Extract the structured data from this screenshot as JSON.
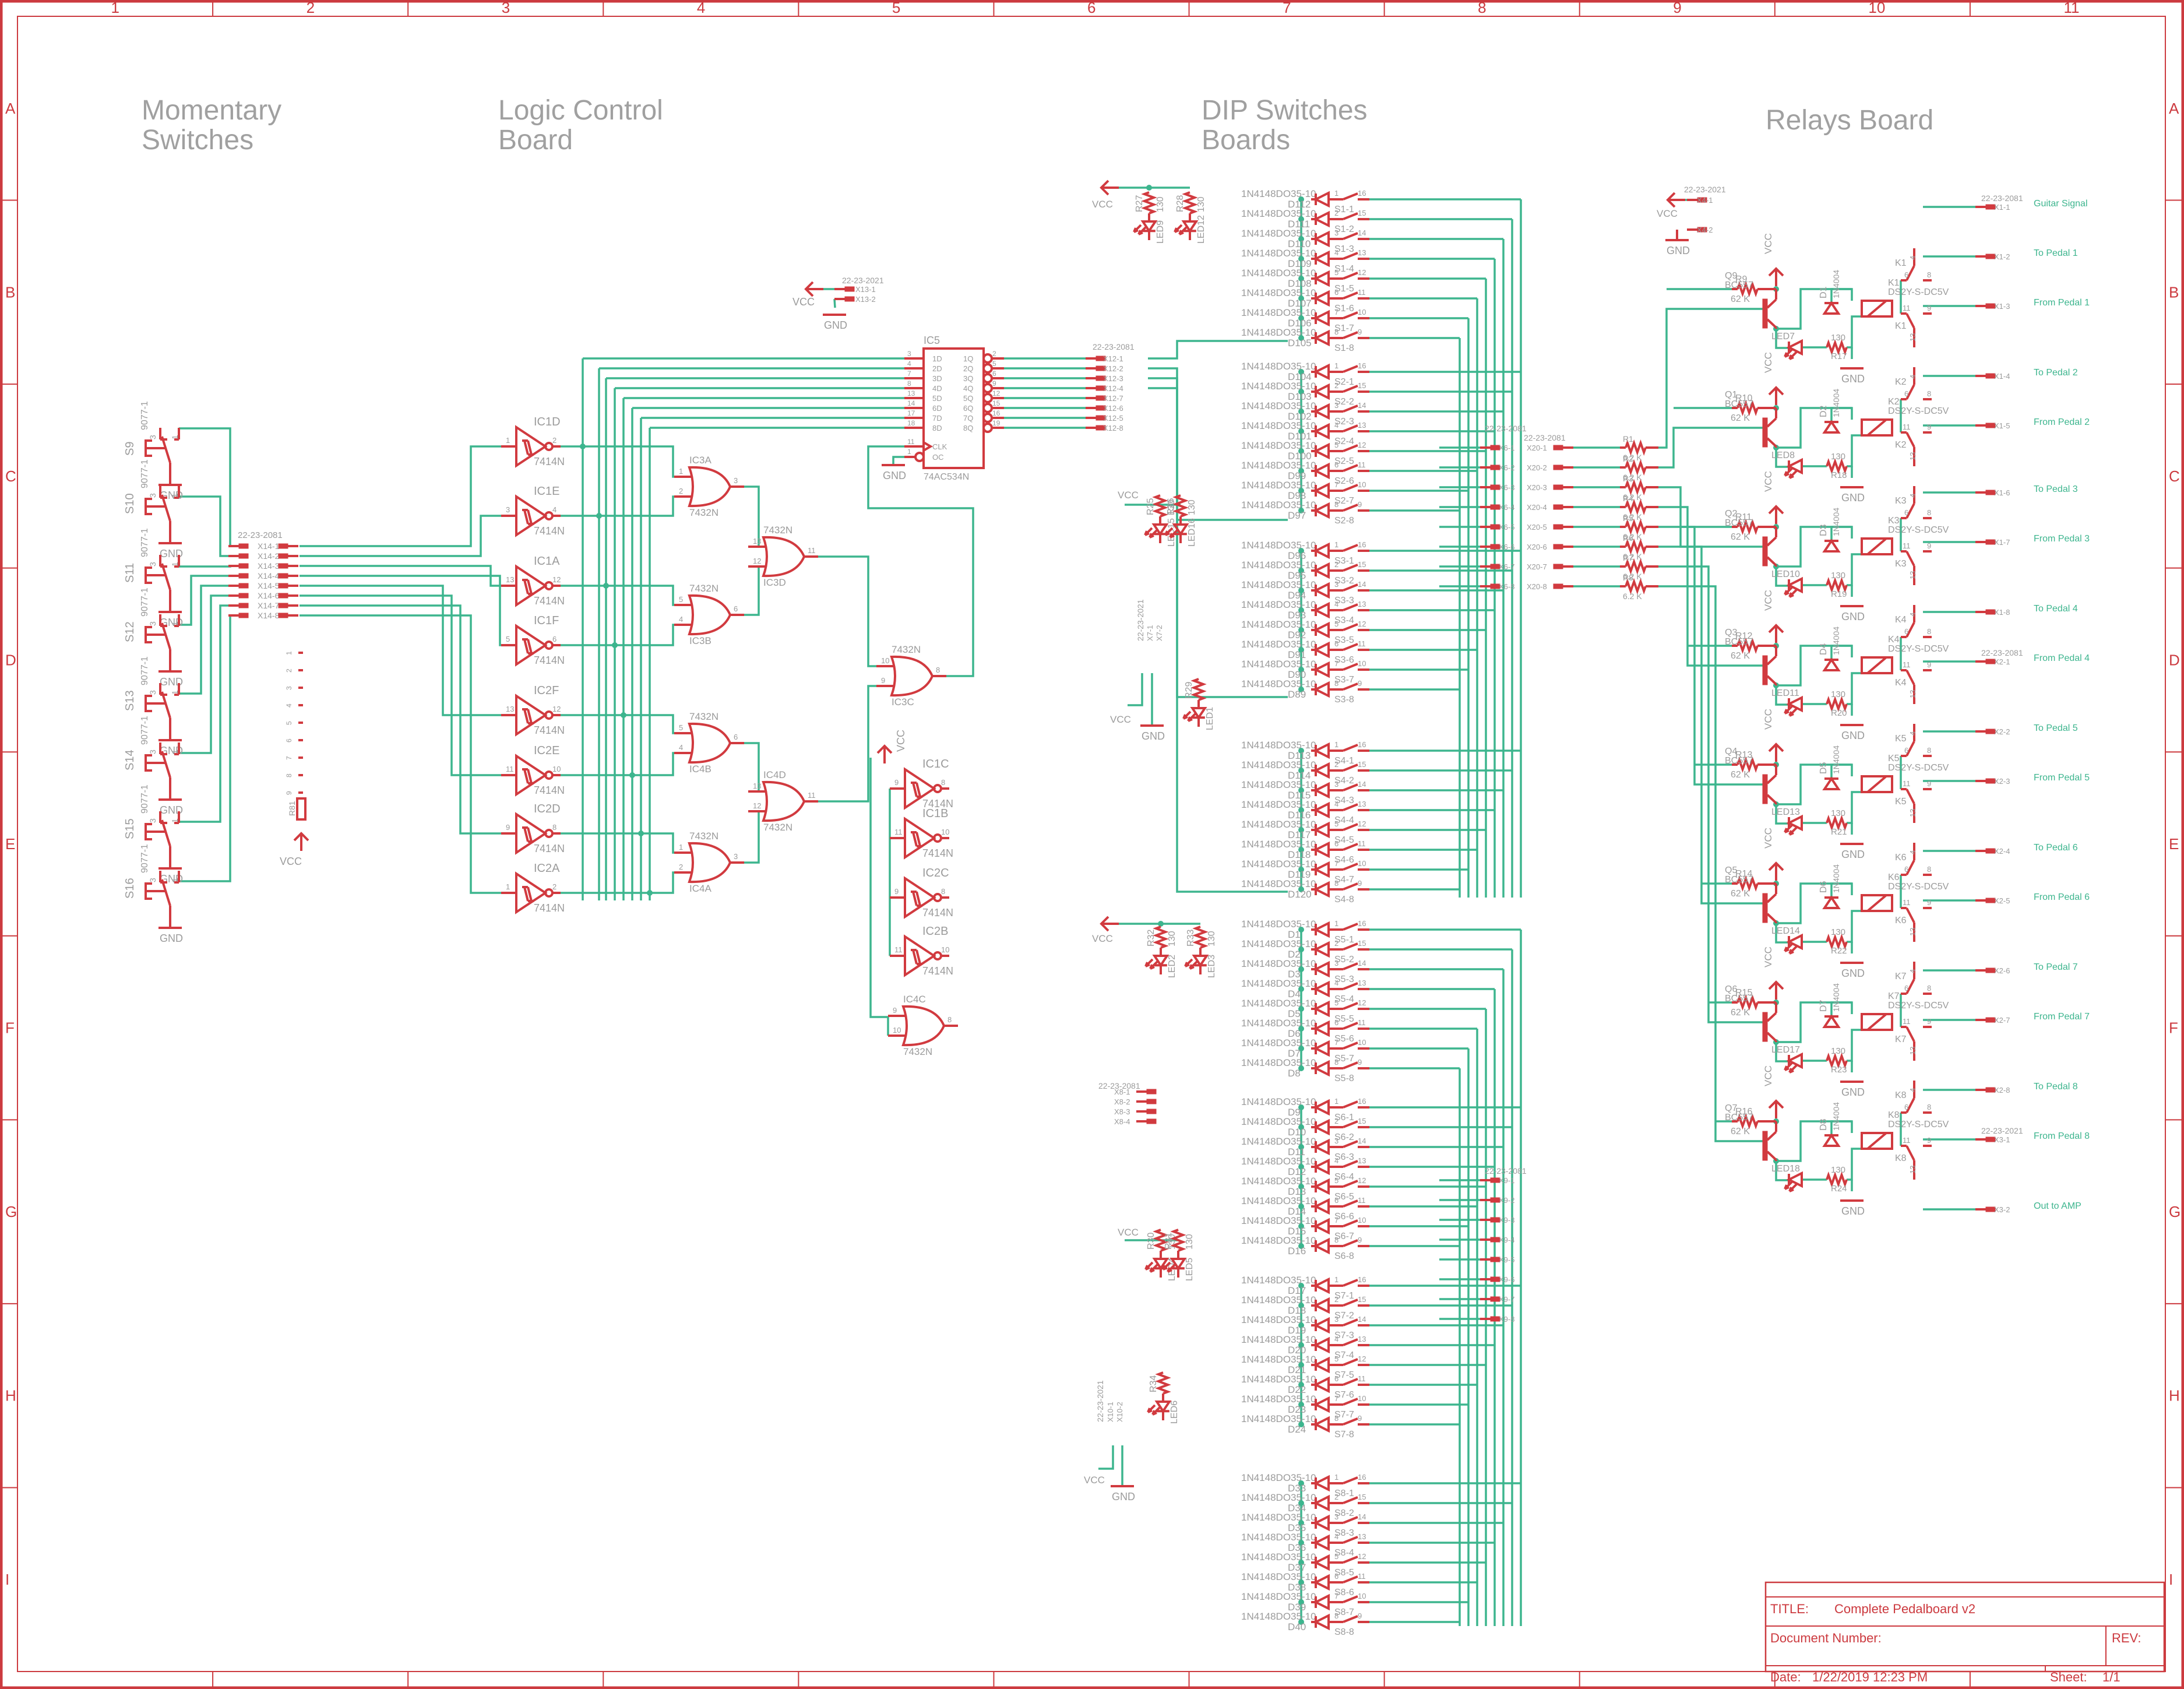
{
  "sheet": {
    "columns": [
      "1",
      "2",
      "3",
      "4",
      "5",
      "6",
      "7",
      "8",
      "9",
      "10",
      "11"
    ],
    "rows": [
      "A",
      "B",
      "C",
      "D",
      "E",
      "F",
      "G",
      "H",
      "I"
    ],
    "colors": {
      "frame": "#cc3a3f",
      "symbol": "#d13a3f",
      "wire": "#3db58e",
      "label": "#9b9b9b",
      "section": "#a0a0a0"
    }
  },
  "sections": {
    "momentary": [
      "Momentary",
      "Switches"
    ],
    "logic": [
      "Logic Control",
      "Board"
    ],
    "dip": [
      "DIP Switches",
      "Boards"
    ],
    "relays": [
      "Relays Board"
    ]
  },
  "title_block": {
    "title_label": "TITLE:",
    "title": "Complete Pedalboard v2",
    "docnum_label": "Document Number:",
    "rev_label": "REV:",
    "date_label": "Date:",
    "date": "1/22/2019 12:23 PM",
    "sheet_label": "Sheet:",
    "sheet": "1/1"
  },
  "momentary_switches": {
    "part": "9077-1",
    "gnd": "GND",
    "items": [
      "S9",
      "S10",
      "S11",
      "S12",
      "S13",
      "S14",
      "S15",
      "S16"
    ],
    "connector_part": "22-23-2081",
    "connector_pins": [
      "X14-1",
      "X14-2",
      "X14-3",
      "X14-4",
      "X14-5",
      "X14-6",
      "X14-7",
      "X14-8"
    ],
    "resistor": "R81",
    "vcc": "VCC"
  },
  "logic_board": {
    "inverters_left": [
      {
        "name": "IC1D",
        "part": "7414N",
        "in": "1",
        "out": "2"
      },
      {
        "name": "IC1E",
        "part": "7414N",
        "in": "3",
        "out": "4"
      },
      {
        "name": "IC1A",
        "part": "7414N",
        "in": "13",
        "out": "12"
      },
      {
        "name": "IC1F",
        "part": "7414N",
        "in": "5",
        "out": "6"
      },
      {
        "name": "IC2F",
        "part": "7414N",
        "in": "13",
        "out": "12"
      },
      {
        "name": "IC2E",
        "part": "7414N",
        "in": "11",
        "out": "10"
      },
      {
        "name": "IC2D",
        "part": "7414N",
        "in": "9",
        "out": "8"
      },
      {
        "name": "IC2A",
        "part": "7414N",
        "in": "1",
        "out": "2"
      }
    ],
    "or_gates": [
      {
        "name": "IC3A",
        "part": "7432N",
        "in": [
          "1",
          "2"
        ],
        "out": "3"
      },
      {
        "name": "IC3B",
        "part": "7432N",
        "in": [
          "5",
          "4"
        ],
        "out": "6"
      },
      {
        "name": "IC3D",
        "part": "7432N",
        "in": [
          "13",
          "12"
        ],
        "out": "11"
      },
      {
        "name": "IC4B",
        "part": "7432N",
        "in": [
          "5",
          "4"
        ],
        "out": "6"
      },
      {
        "name": "IC4A",
        "part": "7432N",
        "in": [
          "1",
          "2"
        ],
        "out": "3"
      },
      {
        "name": "IC4D",
        "part": "7432N",
        "in": [
          "13",
          "12"
        ],
        "out": "11"
      },
      {
        "name": "IC3C",
        "part": "7432N",
        "in": [
          "10",
          "9"
        ],
        "out": "8"
      },
      {
        "name": "IC4C",
        "part": "7432N",
        "in": [
          "9",
          "10"
        ],
        "out": "8"
      }
    ],
    "inverters_unused": [
      {
        "name": "IC1C",
        "part": "7414N",
        "in": "9",
        "out": "8"
      },
      {
        "name": "IC1B",
        "part": "7414N",
        "in": "11",
        "out": "10"
      },
      {
        "name": "IC2C",
        "part": "7414N",
        "in": "9",
        "out": "8"
      },
      {
        "name": "IC2B",
        "part": "7414N",
        "in": "11",
        "out": "10"
      }
    ],
    "latch": {
      "name": "IC5",
      "part": "74AC534N",
      "d_pins": [
        [
          "3",
          "1D"
        ],
        [
          "4",
          "2D"
        ],
        [
          "7",
          "3D"
        ],
        [
          "8",
          "4D"
        ],
        [
          "13",
          "5D"
        ],
        [
          "14",
          "6D"
        ],
        [
          "17",
          "7D"
        ],
        [
          "18",
          "8D"
        ]
      ],
      "q_pins": [
        [
          "2",
          "1Q"
        ],
        [
          "5",
          "2Q"
        ],
        [
          "6",
          "3Q"
        ],
        [
          "9",
          "4Q"
        ],
        [
          "12",
          "5Q"
        ],
        [
          "15",
          "6Q"
        ],
        [
          "16",
          "7Q"
        ],
        [
          "19",
          "8Q"
        ]
      ],
      "clk": [
        "11",
        "CLK"
      ],
      "oc": [
        "1",
        "OC"
      ]
    },
    "latch_connector_part": "22-23-2081",
    "latch_connector_pins": [
      "X12-1",
      "X12-2",
      "X12-3",
      "X12-4",
      "X12-7",
      "X12-6",
      "X12-5",
      "X12-8"
    ],
    "power_connector": {
      "part": "22-23-2021",
      "pins": [
        "X13-1",
        "X13-2"
      ]
    },
    "vcc": "VCC",
    "gnd": "GND"
  },
  "dip_boards": {
    "diode_part": "1N4148DO35-10",
    "banks": [
      {
        "switch": "S1",
        "diodes": [
          "D112",
          "D111",
          "D110",
          "D109",
          "D108",
          "D107",
          "D106",
          "D105"
        ]
      },
      {
        "switch": "S2",
        "diodes": [
          "D104",
          "D103",
          "D102",
          "D101",
          "D100",
          "D99",
          "D98",
          "D97"
        ]
      },
      {
        "switch": "S3",
        "diodes": [
          "D96",
          "D95",
          "D94",
          "D93",
          "D92",
          "D91",
          "D90",
          "D89"
        ]
      },
      {
        "switch": "S4",
        "diodes": [
          "D113",
          "D114",
          "D115",
          "D116",
          "D117",
          "D118",
          "D119",
          "D120"
        ]
      },
      {
        "switch": "S5",
        "diodes": [
          "D1",
          "D2",
          "D3",
          "D4",
          "D5",
          "D6",
          "D7",
          "D8"
        ]
      },
      {
        "switch": "S6",
        "diodes": [
          "D9",
          "D10",
          "D11",
          "D12",
          "D13",
          "D14",
          "D15",
          "D16"
        ]
      },
      {
        "switch": "S7",
        "diodes": [
          "D17",
          "D18",
          "D19",
          "D20",
          "D21",
          "D22",
          "D23",
          "D24"
        ]
      },
      {
        "switch": "S8",
        "diodes": [
          "D33",
          "D34",
          "D35",
          "D36",
          "D37",
          "D38",
          "D39",
          "D40"
        ]
      }
    ],
    "left_pins": [
      "1",
      "2",
      "3",
      "4",
      "5",
      "6",
      "7",
      "8"
    ],
    "right_pins": [
      "16",
      "15",
      "14",
      "13",
      "12",
      "11",
      "10",
      "9"
    ],
    "indicator_leds": [
      {
        "r": "R27",
        "v": "130",
        "led": "LED9"
      },
      {
        "r": "R28",
        "v": "130",
        "led": "LED12"
      },
      {
        "r": "R25",
        "v": "130",
        "led": "LED15"
      },
      {
        "r": "R26",
        "v": "130",
        "led": "LED16"
      },
      {
        "r": "R29",
        "v": "",
        "led": "LED1"
      },
      {
        "r": "R32",
        "v": "130",
        "led": "LED2"
      },
      {
        "r": "R33",
        "v": "130",
        "led": "LED3"
      },
      {
        "r": "R30",
        "v": "130",
        "led": "LED4"
      },
      {
        "r": "R31",
        "v": "130",
        "led": "LED5"
      },
      {
        "r": "R34",
        "v": "",
        "led": "LED6"
      }
    ],
    "connectors": {
      "x6": {
        "part": "22-23-2081",
        "pins": [
          "X6-1",
          "X6-2",
          "X6-3",
          "X6-4",
          "X6-5",
          "X6-6",
          "X6-7",
          "X6-8"
        ]
      },
      "x7": {
        "part": "22-23-2021",
        "pins": [
          "X7-1",
          "X7-2"
        ]
      },
      "x8": {
        "part": "22-23-2081",
        "pins": [
          "X8-1",
          "X8-2",
          "X8-3",
          "X8-4"
        ]
      },
      "x9": {
        "part": "22-23-2081",
        "pins": [
          "X9-1",
          "X9-2",
          "X9-3",
          "X9-4",
          "X9-5",
          "X9-6",
          "X9-7",
          "X9-8"
        ]
      },
      "x10": {
        "part": "22-23-2021",
        "pins": [
          "X10-1",
          "X10-2"
        ]
      }
    },
    "vcc": "VCC",
    "gnd": "GND"
  },
  "relay_board": {
    "input_connector": {
      "part": "22-23-2081",
      "pins": [
        "X20-1",
        "X20-2",
        "X20-3",
        "X20-4",
        "X20-5",
        "X20-6",
        "X20-7",
        "X20-8"
      ]
    },
    "input_resistors": [
      {
        "name": "R1",
        "value": "6.2 K"
      },
      {
        "name": "R2",
        "value": "6.2 K"
      },
      {
        "name": "R3",
        "value": "6.2 K"
      },
      {
        "name": "R4",
        "value": "6.2 K"
      },
      {
        "name": "R5",
        "value": "6.2 K"
      },
      {
        "name": "R6",
        "value": "6.2 K"
      },
      {
        "name": "R7",
        "value": "6.2 K"
      },
      {
        "name": "R8",
        "value": "6.2 K"
      }
    ],
    "power_connector": {
      "part": "22-23-2021",
      "pins": [
        "X4-1",
        "X4-2"
      ]
    },
    "channels": [
      {
        "q": "Q9",
        "qpart": "BC557",
        "rb": "R9",
        "rbv": "62 K",
        "d": "D1",
        "dpart": "1N4004",
        "k": "K1",
        "kpart": "DS2Y-S-DC5V",
        "led": "LED7",
        "rl": "R17",
        "rlv": "130"
      },
      {
        "q": "Q1",
        "qpart": "BC557",
        "rb": "R10",
        "rbv": "62 K",
        "d": "D2",
        "dpart": "1N4004",
        "k": "K2",
        "kpart": "DS2Y-S-DC5V",
        "led": "LED8",
        "rl": "R18",
        "rlv": "130"
      },
      {
        "q": "Q2",
        "qpart": "BC557",
        "rb": "R11",
        "rbv": "62 K",
        "d": "D3",
        "dpart": "1N4004",
        "k": "K3",
        "kpart": "DS2Y-S-DC5V",
        "led": "LED10",
        "rl": "R19",
        "rlv": "130"
      },
      {
        "q": "Q3",
        "qpart": "BC557",
        "rb": "R12",
        "rbv": "62 K",
        "d": "D4",
        "dpart": "1N4004",
        "k": "K4",
        "kpart": "DS2Y-S-DC5V",
        "led": "LED11",
        "rl": "R20",
        "rlv": "130"
      },
      {
        "q": "Q4",
        "qpart": "BC557",
        "rb": "R13",
        "rbv": "62 K",
        "d": "D5",
        "dpart": "1N4004",
        "k": "K5",
        "kpart": "DS2Y-S-DC5V",
        "led": "LED13",
        "rl": "R21",
        "rlv": "130"
      },
      {
        "q": "Q5",
        "qpart": "BC557",
        "rb": "R14",
        "rbv": "62 K",
        "d": "D6",
        "dpart": "1N4004",
        "k": "K6",
        "kpart": "DS2Y-S-DC5V",
        "led": "LED14",
        "rl": "R22",
        "rlv": "130"
      },
      {
        "q": "Q6",
        "qpart": "BC557",
        "rb": "R15",
        "rbv": "62 K",
        "d": "D7",
        "dpart": "1N4004",
        "k": "K7",
        "kpart": "DS2Y-S-DC5V",
        "led": "LED17",
        "rl": "R23",
        "rlv": "130"
      },
      {
        "q": "Q7",
        "qpart": "BC557",
        "rb": "R16",
        "rbv": "62 K",
        "d": "D8",
        "dpart": "1N4004",
        "k": "K8",
        "kpart": "DS2Y-S-DC5V",
        "led": "LED18",
        "rl": "R24",
        "rlv": "130"
      }
    ],
    "audio_connectors": [
      {
        "part": "22-23-2081",
        "pin": "X1-1",
        "label": "Guitar Signal"
      },
      {
        "part": "",
        "pin": "X1-2",
        "label": "To Pedal 1"
      },
      {
        "part": "",
        "pin": "X1-3",
        "label": "From Pedal 1"
      },
      {
        "part": "",
        "pin": "X1-4",
        "label": "To Pedal 2"
      },
      {
        "part": "",
        "pin": "X1-5",
        "label": "From Pedal 2"
      },
      {
        "part": "",
        "pin": "X1-6",
        "label": "To Pedal 3"
      },
      {
        "part": "",
        "pin": "X1-7",
        "label": "From Pedal 3"
      },
      {
        "part": "",
        "pin": "X1-8",
        "label": "To Pedal 4"
      },
      {
        "part": "22-23-2081",
        "pin": "X2-1",
        "label": "From Pedal 4"
      },
      {
        "part": "",
        "pin": "X2-2",
        "label": "To Pedal 5"
      },
      {
        "part": "",
        "pin": "X2-3",
        "label": "From Pedal 5"
      },
      {
        "part": "",
        "pin": "X2-4",
        "label": "To Pedal 6"
      },
      {
        "part": "",
        "pin": "X2-5",
        "label": "From Pedal 6"
      },
      {
        "part": "",
        "pin": "X2-6",
        "label": "To Pedal 7"
      },
      {
        "part": "",
        "pin": "X2-7",
        "label": "From Pedal 7"
      },
      {
        "part": "",
        "pin": "X2-8",
        "label": "To Pedal 8"
      },
      {
        "part": "22-23-2021",
        "pin": "X3-1",
        "label": "From Pedal 8"
      },
      {
        "part": "",
        "pin": "X3-2",
        "label": "Out to AMP"
      }
    ],
    "vcc": "VCC",
    "gnd": "GND"
  }
}
